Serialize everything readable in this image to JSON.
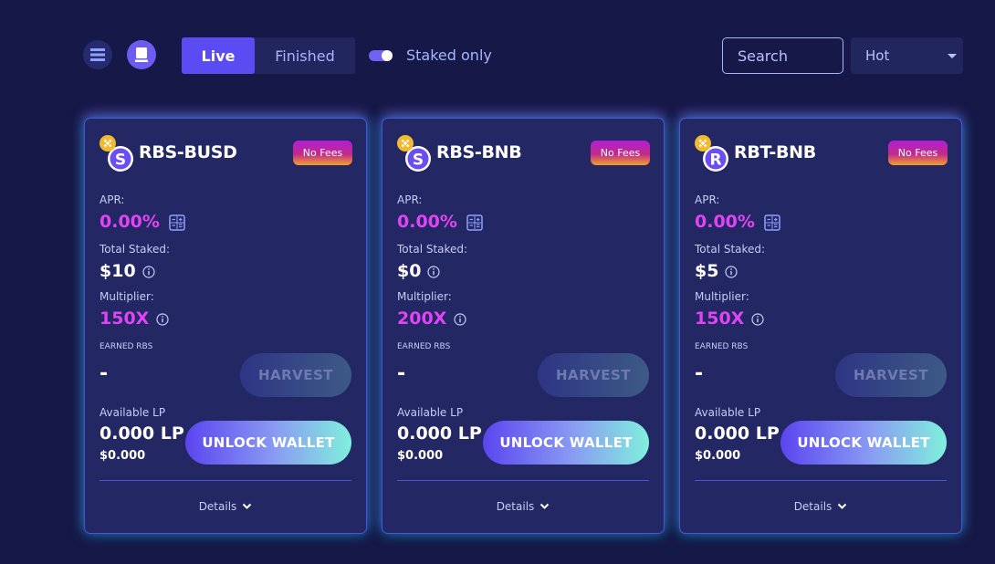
{
  "toolbar": {
    "tabs": [
      {
        "label": "Live",
        "active": true
      },
      {
        "label": "Finished",
        "active": false
      }
    ],
    "staked_only_label": "Staked only",
    "staked_only_on": true,
    "search_placeholder": "Search",
    "sort_value": "Hot",
    "icons": [
      "list-view-icon",
      "card-view-icon"
    ]
  },
  "labels": {
    "apr": "APR:",
    "total_staked": "Total Staked:",
    "multiplier": "Multiplier:",
    "earned": "EARNED RBS",
    "available_lp": "Available LP",
    "harvest": "HARVEST",
    "unlock": "UNLOCK WALLET",
    "details": "Details",
    "no_fees": "No Fees"
  },
  "pools": [
    {
      "name": "RBS-BUSD",
      "apr": "0.00%",
      "total_staked": "$10",
      "multiplier": "150X",
      "earned": "-",
      "lp_amount": "0.000 LP",
      "lp_usd": "$0.000",
      "logo": "S"
    },
    {
      "name": "RBS-BNB",
      "apr": "0.00%",
      "total_staked": "$0",
      "multiplier": "200X",
      "earned": "-",
      "lp_amount": "0.000 LP",
      "lp_usd": "$0.000",
      "logo": "S"
    },
    {
      "name": "RBT-BNB",
      "apr": "0.00%",
      "total_staked": "$5",
      "multiplier": "150X",
      "earned": "-",
      "lp_amount": "0.000 LP",
      "lp_usd": "$0.000",
      "logo": "R"
    }
  ],
  "colors": {
    "background": "#161947",
    "card": "#232764",
    "accent_purple": "#5b4bf2",
    "pink_value": "#e044f5",
    "bnb_yellow": "#f3ba2f"
  }
}
